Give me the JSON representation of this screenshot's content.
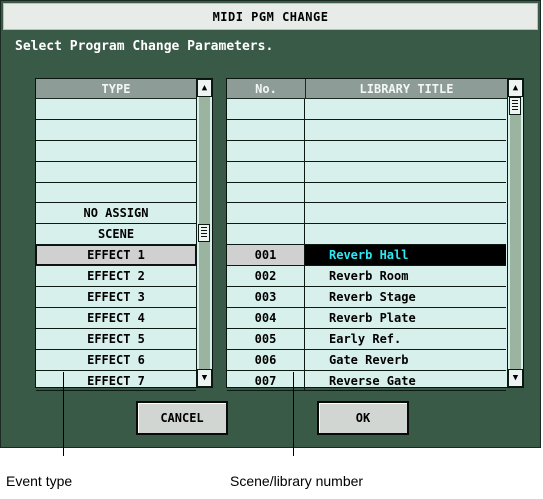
{
  "dialog": {
    "title": "MIDI PGM CHANGE",
    "instruction": "Select Program Change Parameters."
  },
  "type_list": {
    "header": "TYPE",
    "items": [
      "",
      "",
      "",
      "",
      "",
      "NO ASSIGN",
      "SCENE",
      "EFFECT 1",
      "EFFECT 2",
      "EFFECT 3",
      "EFFECT 4",
      "EFFECT 5",
      "EFFECT 6",
      "EFFECT 7"
    ],
    "selected_index": 7,
    "scroll_position": 0.5
  },
  "library_list": {
    "header_number": "No.",
    "header_title": "LIBRARY TITLE",
    "rows": [
      {
        "number": "",
        "title": ""
      },
      {
        "number": "",
        "title": ""
      },
      {
        "number": "",
        "title": ""
      },
      {
        "number": "",
        "title": ""
      },
      {
        "number": "",
        "title": ""
      },
      {
        "number": "",
        "title": ""
      },
      {
        "number": "",
        "title": ""
      },
      {
        "number": "001",
        "title": "Reverb Hall"
      },
      {
        "number": "002",
        "title": "Reverb Room"
      },
      {
        "number": "003",
        "title": "Reverb Stage"
      },
      {
        "number": "004",
        "title": "Reverb Plate"
      },
      {
        "number": "005",
        "title": "Early Ref."
      },
      {
        "number": "006",
        "title": "Gate Reverb"
      },
      {
        "number": "007",
        "title": "Reverse Gate"
      }
    ],
    "selected_index": 7,
    "scroll_position": 0.0
  },
  "buttons": {
    "cancel": "CANCEL",
    "ok": "OK"
  },
  "scrollbar_icons": {
    "up": "scroll-up-arrow-icon",
    "down": "scroll-down-arrow-icon"
  },
  "callouts": {
    "event_type": "Event type",
    "scene_number": "Scene/library number"
  },
  "colors": {
    "dialog_bg": "#3a5a48",
    "list_bg": "#d8f0ec",
    "header_bg": "#8d9c96",
    "selected_title_bg": "#000000",
    "selected_title_text": "#2fe8f2"
  }
}
